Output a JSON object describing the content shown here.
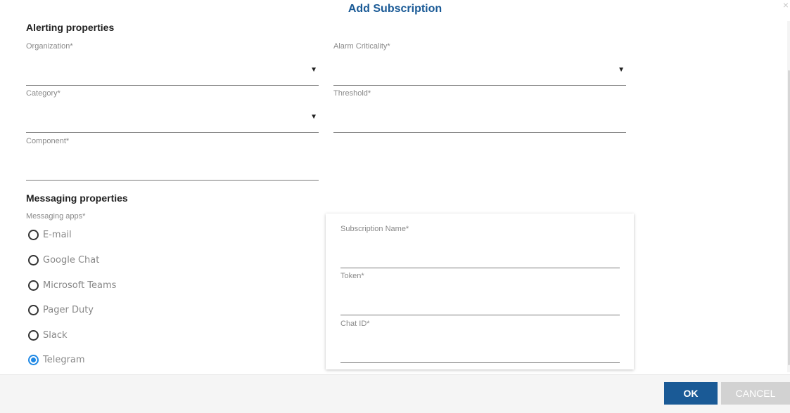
{
  "dialog": {
    "title": "Add Subscription",
    "close_icon": "×"
  },
  "alerting": {
    "title": "Alerting properties",
    "organization": {
      "label": "Organization*",
      "value": ""
    },
    "alarm_criticality": {
      "label": "Alarm Criticality*",
      "value": ""
    },
    "category": {
      "label": "Category*",
      "value": ""
    },
    "threshold": {
      "label": "Threshold*",
      "value": ""
    },
    "component": {
      "label": "Component*",
      "value": ""
    },
    "dropdown_icon": "▼"
  },
  "messaging": {
    "title": "Messaging properties",
    "apps_label": "Messaging apps*",
    "apps": [
      {
        "label": "E-mail",
        "selected": false
      },
      {
        "label": "Google Chat",
        "selected": false
      },
      {
        "label": "Microsoft Teams",
        "selected": false
      },
      {
        "label": "Pager Duty",
        "selected": false
      },
      {
        "label": "Slack",
        "selected": false
      },
      {
        "label": "Telegram",
        "selected": true
      }
    ],
    "details": {
      "subscription_name": {
        "label": "Subscription Name*",
        "value": ""
      },
      "token": {
        "label": "Token*",
        "value": ""
      },
      "chat_id": {
        "label": "Chat ID*",
        "value": ""
      }
    }
  },
  "footer": {
    "ok_label": "OK",
    "cancel_label": "CANCEL"
  },
  "colors": {
    "accent": "#1a5a96",
    "radio_selected": "#1e88e5"
  }
}
